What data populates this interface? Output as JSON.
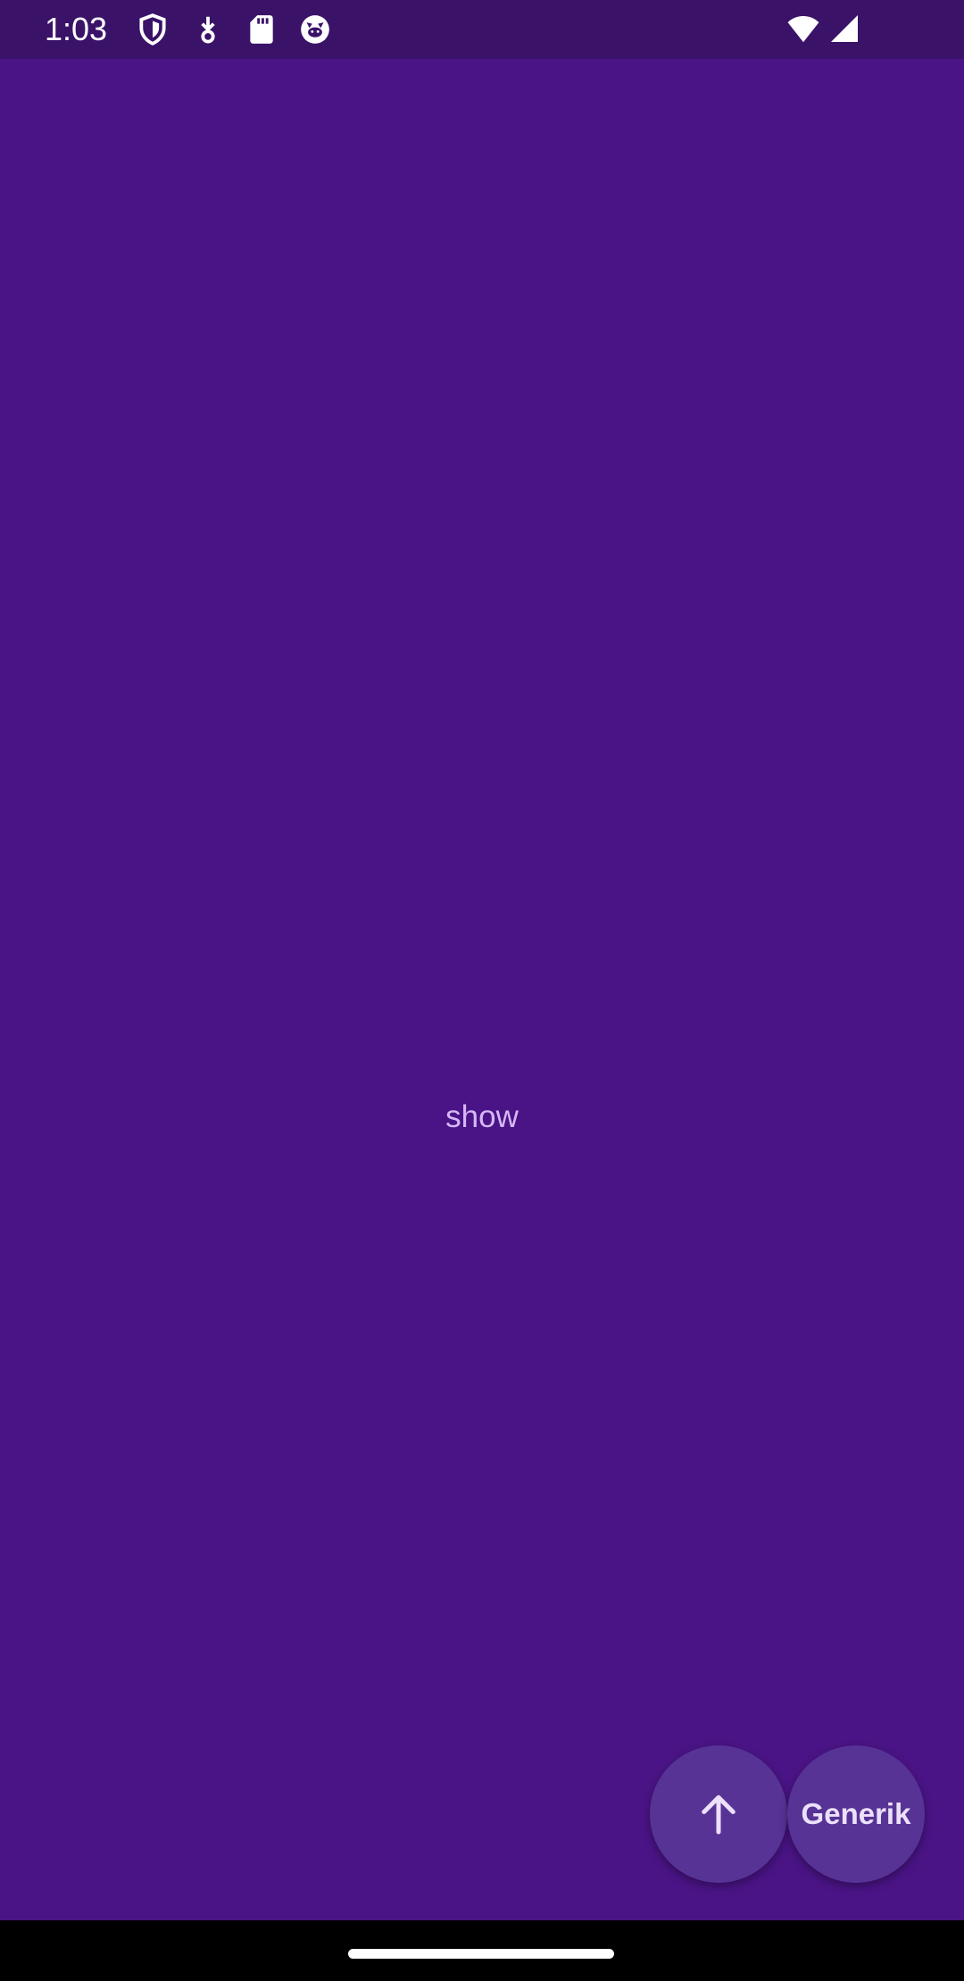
{
  "status_bar": {
    "time": "1:03",
    "left_icons": [
      "shield-icon",
      "download-icon",
      "sd-card-icon",
      "cat-face-icon"
    ],
    "right_icons": [
      "wifi-icon",
      "signal-icon"
    ]
  },
  "main": {
    "center_text": "show"
  },
  "fabs": {
    "up_icon": "arrow-up-icon",
    "generik_label": "Generik"
  },
  "colors": {
    "background": "#4a1486",
    "status_bar": "#3a1268",
    "fab": "#573395",
    "center_text": "#d5b8f5"
  }
}
